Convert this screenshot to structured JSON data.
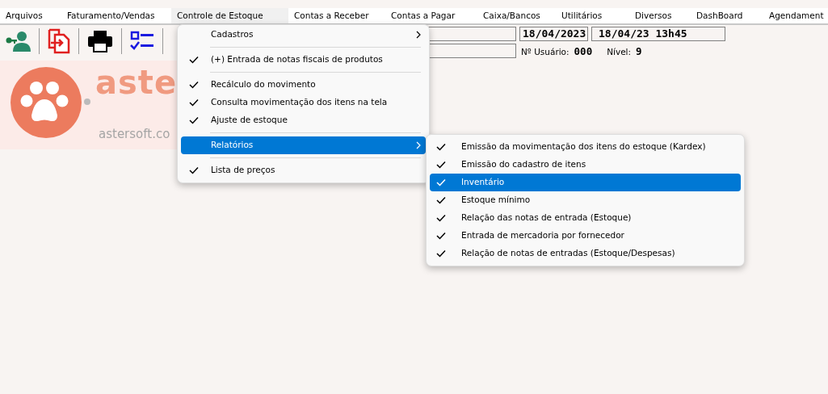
{
  "menubar": [
    {
      "label": "Arquivos",
      "selected": false
    },
    {
      "label": "Faturamento/Vendas",
      "selected": false
    },
    {
      "label": "Controle de Estoque",
      "selected": true
    },
    {
      "label": "Contas a Receber",
      "selected": false
    },
    {
      "label": "Contas a Pagar",
      "selected": false
    },
    {
      "label": "Caixa/Bancos",
      "selected": false
    },
    {
      "label": "Utilitários",
      "selected": false
    },
    {
      "label": "Diversos",
      "selected": false
    },
    {
      "label": "DashBoard",
      "selected": false
    },
    {
      "label": "Agendament",
      "selected": false
    }
  ],
  "logo": {
    "wordmark": "aste",
    "website": "astersoft.co"
  },
  "status": {
    "date": "18/04/2023",
    "datetime": "18/04/23 13h45",
    "user_label": "Nº Usuário:",
    "user_value": "000",
    "level_label": "Nível:",
    "level_value": "9"
  },
  "menu": [
    {
      "kind": "item",
      "label": "Cadastros",
      "checked": false,
      "submenu": true,
      "selected": false
    },
    {
      "kind": "separator"
    },
    {
      "kind": "item",
      "label": "(+) Entrada de notas fiscais de produtos",
      "checked": true,
      "submenu": false,
      "selected": false
    },
    {
      "kind": "separator"
    },
    {
      "kind": "item",
      "label": "Recálculo do movimento",
      "checked": true,
      "submenu": false,
      "selected": false
    },
    {
      "kind": "item",
      "label": "Consulta movimentação dos itens na tela",
      "checked": true,
      "submenu": false,
      "selected": false
    },
    {
      "kind": "item",
      "label": "Ajuste de estoque",
      "checked": true,
      "submenu": false,
      "selected": false
    },
    {
      "kind": "separator"
    },
    {
      "kind": "item",
      "label": "Relatórios",
      "checked": false,
      "submenu": true,
      "selected": true
    },
    {
      "kind": "separator"
    },
    {
      "kind": "item",
      "label": "Lista de preços",
      "checked": true,
      "submenu": false,
      "selected": false
    }
  ],
  "submenu": [
    {
      "label": "Emissão da movimentação dos itens do estoque (Kardex)",
      "checked": true,
      "selected": false
    },
    {
      "label": "Emissão do cadastro de itens",
      "checked": true,
      "selected": false
    },
    {
      "label": "Inventário",
      "checked": true,
      "selected": true
    },
    {
      "label": "Estoque mínimo",
      "checked": true,
      "selected": false
    },
    {
      "label": "Relação das notas de entrada (Estoque)",
      "checked": true,
      "selected": false
    },
    {
      "label": "Entrada de mercadoria por fornecedor",
      "checked": true,
      "selected": false
    },
    {
      "label": "Relação de notas de entradas (Estoque/Despesas)",
      "checked": true,
      "selected": false
    }
  ]
}
